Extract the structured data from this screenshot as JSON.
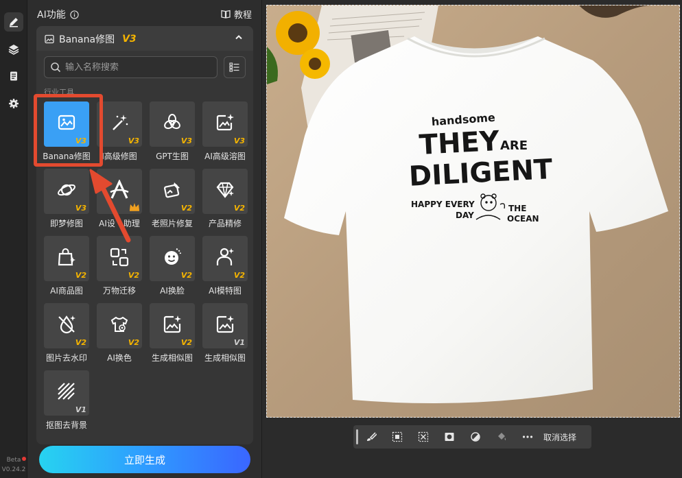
{
  "panel": {
    "title": "AI功能",
    "tutorial": "教程"
  },
  "card": {
    "title": "Banana修图",
    "version": "V3"
  },
  "search": {
    "placeholder": "输入名称搜索"
  },
  "section": "行业工具",
  "tools": [
    {
      "label": "Banana修图",
      "badge": "V3",
      "icon": "image-edit-icon",
      "selected": true
    },
    {
      "label": "I高级修图",
      "badge": "V3",
      "icon": "magic-wand-icon"
    },
    {
      "label": "GPT生图",
      "badge": "V3",
      "icon": "openai-icon"
    },
    {
      "label": "AI高级溶图",
      "badge": "V3",
      "icon": "image-sparkle-icon"
    },
    {
      "label": "即梦修图",
      "badge": "V3",
      "icon": "planet-icon"
    },
    {
      "label": "AI设计助理",
      "label_visible_left": "AI设",
      "label_visible_right": "助理",
      "badge": "",
      "icon": "design-a-icon",
      "crown": true
    },
    {
      "label": "老照片修复",
      "badge": "V2",
      "icon": "photo-restore-icon"
    },
    {
      "label": "产品精修",
      "badge": "V2",
      "icon": "diamond-icon"
    },
    {
      "label": "AI商品图",
      "badge": "V2",
      "icon": "shopping-bag-icon"
    },
    {
      "label": "万物迁移",
      "badge": "V2",
      "icon": "transfer-icon"
    },
    {
      "label": "AI换脸",
      "badge": "V2",
      "icon": "face-swap-icon"
    },
    {
      "label": "AI模特图",
      "badge": "V2",
      "icon": "model-person-icon"
    },
    {
      "label": "图片去水印",
      "badge": "V2",
      "icon": "watermark-remove-icon"
    },
    {
      "label": "AI换色",
      "badge": "V2",
      "icon": "color-tshirt-icon"
    },
    {
      "label": "生成相似图",
      "badge": "V2",
      "icon": "similar-image-icon"
    },
    {
      "label": "生成相似图",
      "badge": "V1",
      "icon": "similar-image-icon"
    },
    {
      "label": "抠图去背景",
      "badge": "V1",
      "icon": "cutout-icon"
    }
  ],
  "generate_button": "立即生成",
  "sidebar": {
    "beta": "Beta",
    "version": "V0.24.2"
  },
  "shirt": {
    "line1": "handsome",
    "line2a": "THEY",
    "line2b": "ARE",
    "line3": "DILIGENT",
    "line4a": "HAPPY EVERY",
    "line4b": "DAY",
    "line4c": "THE",
    "line4d": "OCEAN"
  },
  "toolbar": {
    "deselect": "取消选择"
  },
  "colors": {
    "accent": "#3aa0f5",
    "badge": "#f5b400",
    "highlight": "#e34a2f"
  }
}
